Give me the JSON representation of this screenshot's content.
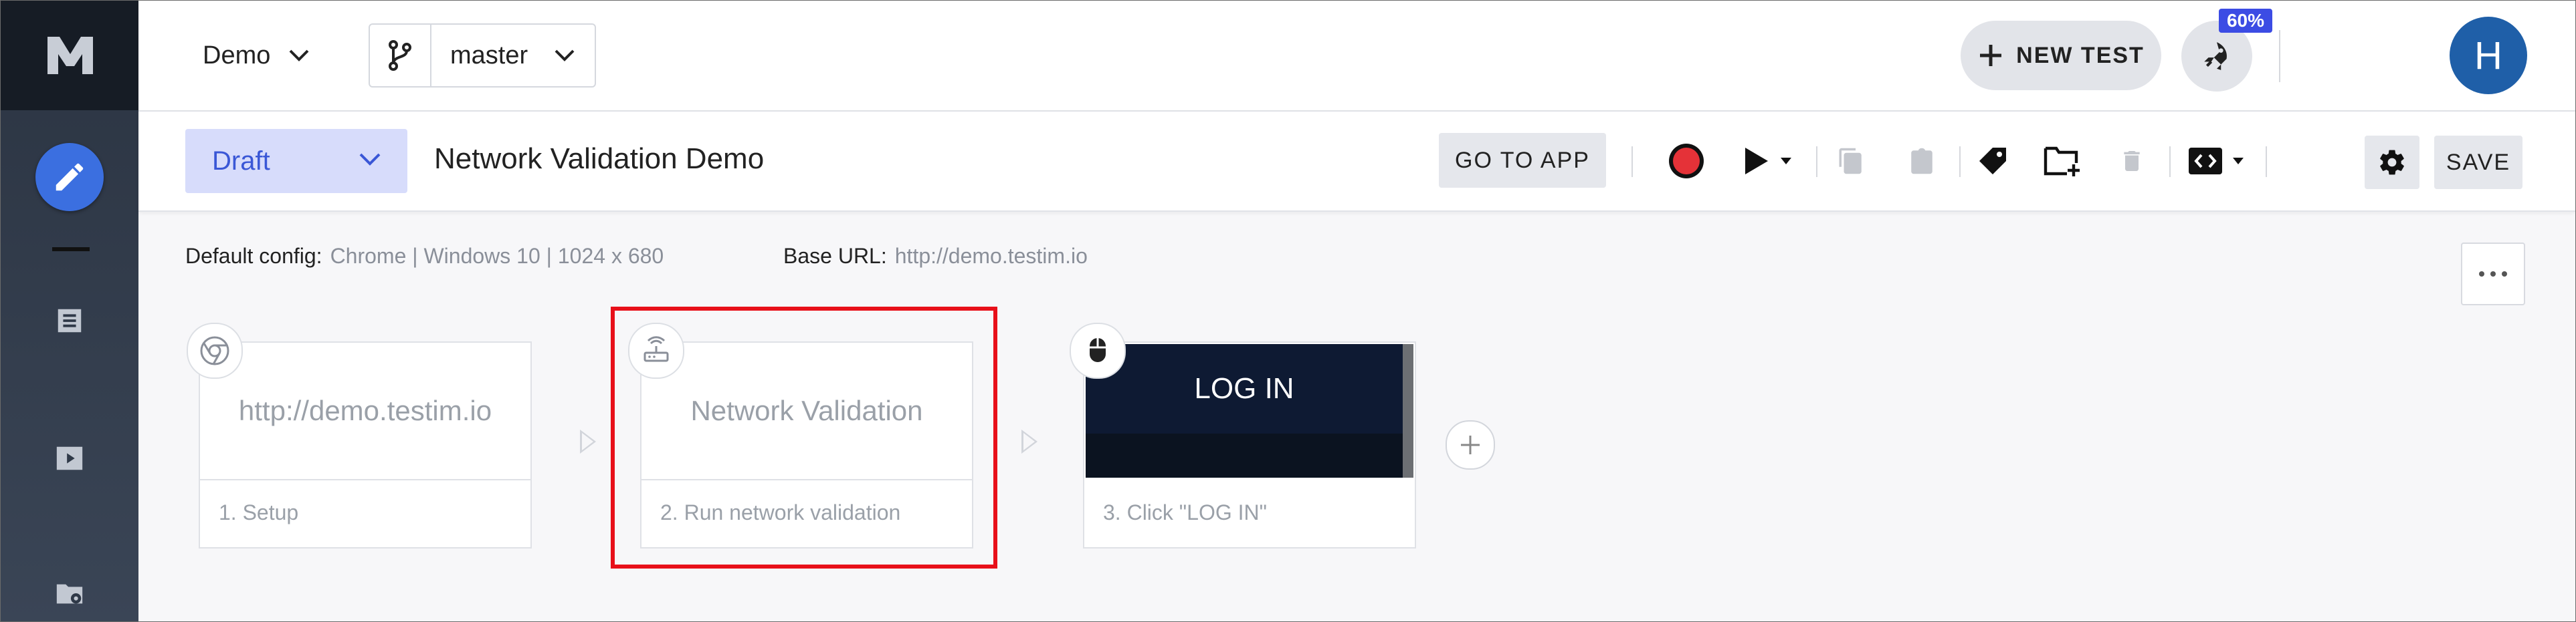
{
  "header": {
    "project": "Demo",
    "branch": "master",
    "new_test_label": "NEW TEST",
    "rocket_badge": "60%",
    "avatar_initial": "H"
  },
  "toolbar": {
    "status": "Draft",
    "test_name": "Network Validation Demo",
    "go_to_app": "GO TO APP",
    "save": "SAVE"
  },
  "info": {
    "default_config_label": "Default config:",
    "default_config_value": "Chrome | Windows 10 | 1024 x 680",
    "base_url_label": "Base URL:",
    "base_url_value": "http://demo.testim.io"
  },
  "steps": [
    {
      "preview": "http://demo.testim.io",
      "title": "1. Setup",
      "icon": "chrome-icon"
    },
    {
      "preview": "Network Validation",
      "title": "2. Run network validation",
      "icon": "router-icon"
    },
    {
      "preview": "LOG IN",
      "title": "3. Click \"LOG IN\"",
      "icon": "mouse-icon"
    }
  ],
  "colors": {
    "accent": "#3b6fe0",
    "highlight": "#e8101a",
    "record": "#e53238",
    "badge": "#3c4ce4",
    "avatar": "#1f5fa8"
  }
}
